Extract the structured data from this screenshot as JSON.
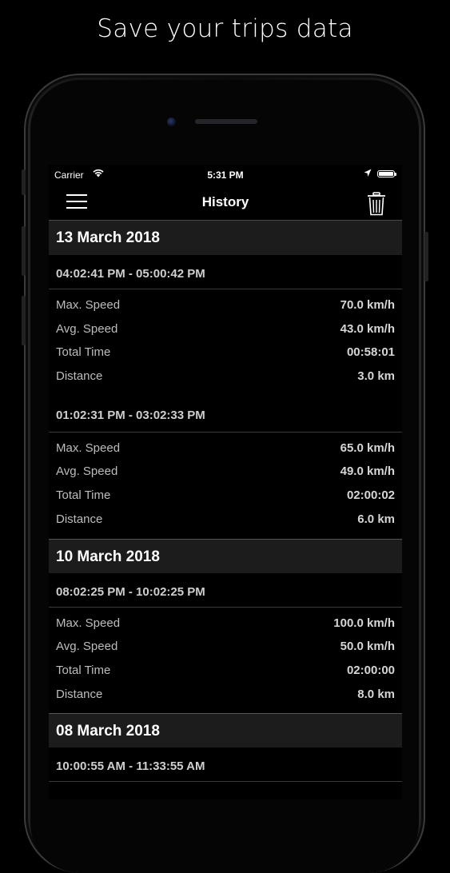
{
  "headline": "Save your trips data",
  "status_bar": {
    "carrier": "Carrier",
    "time": "5:31 PM"
  },
  "nav": {
    "title": "History",
    "menu_icon": "hamburger-menu-icon",
    "trash_icon": "trash-icon"
  },
  "days": [
    {
      "date": "13 March 2018",
      "trips": [
        {
          "time_range": "04:02:41 PM - 05:00:42 PM",
          "stats": [
            {
              "label": "Max. Speed",
              "value": "70.0 km/h"
            },
            {
              "label": "Avg. Speed",
              "value": "43.0 km/h"
            },
            {
              "label": "Total Time",
              "value": "00:58:01"
            },
            {
              "label": "Distance",
              "value": "3.0 km"
            }
          ]
        },
        {
          "time_range": "01:02:31 PM - 03:02:33 PM",
          "stats": [
            {
              "label": "Max. Speed",
              "value": "65.0 km/h"
            },
            {
              "label": "Avg. Speed",
              "value": "49.0 km/h"
            },
            {
              "label": "Total Time",
              "value": "02:00:02"
            },
            {
              "label": "Distance",
              "value": "6.0 km"
            }
          ]
        }
      ]
    },
    {
      "date": "10 March 2018",
      "trips": [
        {
          "time_range": "08:02:25 PM - 10:02:25 PM",
          "stats": [
            {
              "label": "Max. Speed",
              "value": "100.0 km/h"
            },
            {
              "label": "Avg. Speed",
              "value": "50.0 km/h"
            },
            {
              "label": "Total Time",
              "value": "02:00:00"
            },
            {
              "label": "Distance",
              "value": "8.0 km"
            }
          ]
        }
      ]
    },
    {
      "date": "08 March 2018",
      "trips": [
        {
          "time_range": "10:00:55 AM - 11:33:55 AM",
          "stats": []
        }
      ]
    }
  ]
}
